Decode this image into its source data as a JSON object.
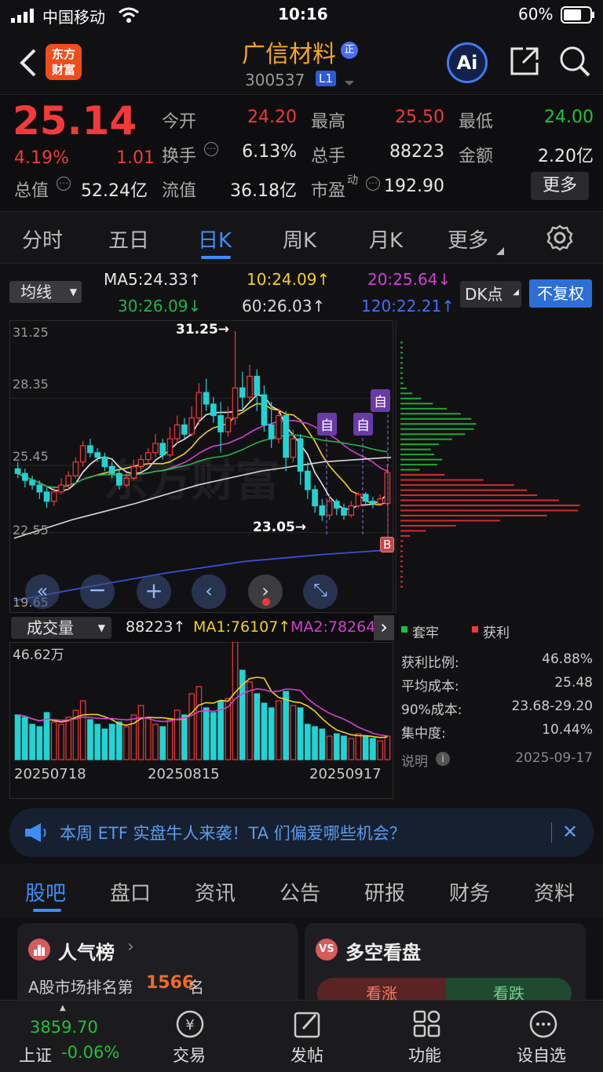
{
  "status": {
    "carrier": "中国移动",
    "time": "10:16",
    "battery": "60%"
  },
  "header": {
    "logo_line1": "东方",
    "logo_line2": "财富",
    "stock_name": "广信材料",
    "badge": "正",
    "code": "300537",
    "level": "L1",
    "ai": "Ai"
  },
  "quote": {
    "price": "25.14",
    "change_pct": "4.19%",
    "change": "1.01",
    "fields": [
      {
        "label": "今开",
        "value": "24.20"
      },
      {
        "label": "最高",
        "value": "25.50"
      },
      {
        "label": "最低",
        "value": "24.00"
      },
      {
        "label": "换手",
        "value": "6.13%"
      },
      {
        "label": "总手",
        "value": "88223"
      },
      {
        "label": "金额",
        "value": "2.20亿"
      },
      {
        "label": "总值",
        "value": "52.24亿"
      },
      {
        "label": "流值",
        "value": "36.18亿"
      },
      {
        "label": "市盈",
        "label_sup": "动",
        "value": "192.90"
      }
    ],
    "more": "更多"
  },
  "tabs": [
    "分时",
    "五日",
    "日K",
    "周K",
    "月K",
    "更多"
  ],
  "ma_bar": {
    "selector": "均线",
    "items": [
      {
        "text": "MA5:24.33↑",
        "color": "#e6e6e6"
      },
      {
        "text": "10:24.09↑",
        "color": "#f2d023"
      },
      {
        "text": "20:25.64↓",
        "color": "#d43fd4"
      },
      {
        "text": "30:26.09↓",
        "color": "#22b34a"
      },
      {
        "text": "60:26.03↑",
        "color": "#d9d9d9"
      },
      {
        "text": "120:22.21↑",
        "color": "#4a6cf0"
      }
    ],
    "dk": "DK点",
    "fq": "不复权"
  },
  "chart_data": {
    "type": "candlestick",
    "y_ticks": [
      "31.25",
      "28.35",
      "25.45",
      "22.55",
      "19.65"
    ],
    "ylim": [
      19.65,
      31.25
    ],
    "annotations": {
      "high": "31.25→",
      "low": "23.05→",
      "marker": "自",
      "buy": "B"
    },
    "watermark": "东方财富",
    "candles": [
      [
        25.3,
        25.1,
        24.9,
        25.6
      ],
      [
        25.1,
        24.8,
        24.5,
        25.3
      ],
      [
        24.8,
        24.6,
        24.4,
        25.0
      ],
      [
        24.6,
        24.3,
        24.0,
        24.8
      ],
      [
        24.3,
        23.9,
        23.6,
        24.5
      ],
      [
        23.9,
        24.3,
        23.7,
        24.5
      ],
      [
        24.3,
        24.6,
        24.2,
        24.9
      ],
      [
        24.6,
        25.0,
        24.4,
        25.2
      ],
      [
        25.0,
        25.6,
        24.9,
        25.8
      ],
      [
        25.6,
        26.3,
        25.4,
        26.5
      ],
      [
        26.3,
        26.0,
        25.8,
        26.6
      ],
      [
        26.0,
        25.8,
        25.6,
        26.2
      ],
      [
        25.8,
        25.4,
        25.2,
        26.0
      ],
      [
        25.4,
        25.1,
        24.9,
        25.6
      ],
      [
        25.1,
        24.6,
        24.4,
        25.3
      ],
      [
        24.6,
        24.9,
        24.5,
        25.1
      ],
      [
        24.9,
        25.4,
        24.8,
        25.7
      ],
      [
        25.4,
        25.7,
        25.2,
        25.9
      ],
      [
        25.7,
        26.0,
        25.5,
        26.2
      ],
      [
        26.0,
        26.4,
        25.8,
        26.8
      ],
      [
        26.4,
        25.9,
        25.7,
        26.6
      ],
      [
        25.9,
        26.6,
        25.8,
        27.1
      ],
      [
        26.6,
        27.2,
        26.4,
        27.6
      ],
      [
        27.2,
        26.8,
        26.6,
        27.5
      ],
      [
        26.8,
        27.5,
        26.7,
        28.0
      ],
      [
        27.5,
        28.6,
        27.2,
        29.0
      ],
      [
        28.6,
        28.1,
        27.8,
        29.2
      ],
      [
        28.1,
        27.6,
        27.3,
        28.4
      ],
      [
        27.6,
        26.9,
        26.0,
        28.2
      ],
      [
        26.9,
        27.5,
        26.7,
        28.0
      ],
      [
        27.5,
        28.8,
        27.2,
        31.25
      ],
      [
        28.8,
        28.4,
        27.9,
        29.5
      ],
      [
        28.4,
        29.3,
        28.2,
        29.8
      ],
      [
        29.3,
        28.5,
        27.8,
        29.6
      ],
      [
        28.5,
        27.2,
        26.9,
        28.9
      ],
      [
        27.2,
        26.6,
        26.2,
        28.2
      ],
      [
        26.6,
        27.6,
        26.4,
        27.9
      ],
      [
        27.6,
        25.8,
        25.2,
        27.8
      ],
      [
        25.8,
        26.6,
        25.6,
        27.0
      ],
      [
        26.6,
        25.2,
        24.6,
        26.8
      ],
      [
        25.2,
        24.4,
        24.0,
        25.6
      ],
      [
        24.4,
        23.7,
        23.4,
        24.6
      ],
      [
        23.7,
        23.3,
        23.05,
        24.0
      ],
      [
        23.3,
        23.9,
        23.1,
        24.2
      ],
      [
        23.9,
        23.6,
        23.3,
        24.0
      ],
      [
        23.6,
        23.3,
        23.1,
        23.8
      ],
      [
        23.3,
        23.7,
        23.2,
        23.9
      ],
      [
        23.7,
        24.2,
        23.6,
        24.3
      ],
      [
        24.2,
        23.9,
        23.7,
        24.3
      ],
      [
        23.9,
        23.8,
        23.6,
        24.1
      ],
      [
        23.8,
        24.0,
        23.7,
        24.2
      ],
      [
        23.8,
        25.14,
        23.7,
        25.5
      ]
    ],
    "volume": {
      "max_label": "46.62万",
      "value": "88223↑",
      "ma1": "MA1:76107↑",
      "ma2": "MA2:78264↑"
    },
    "dates": [
      "20250718",
      "20250815",
      "20250917"
    ]
  },
  "vol_selector": "成交量",
  "chip": {
    "legend": [
      "套牢",
      "获利"
    ],
    "rows": [
      {
        "label": "获利比例:",
        "value": "46.88%"
      },
      {
        "label": "平均成本:",
        "value": "25.48"
      },
      {
        "label": "90%成本:",
        "value": "23.68-29.20"
      },
      {
        "label": "集中度:",
        "value": "10.44%"
      }
    ],
    "note": "说明",
    "date": "2025-09-17"
  },
  "banner": "本周 ETF 实盘牛人来袭！TA 们偏爱哪些机会？",
  "bottom_tabs": [
    "股吧",
    "盘口",
    "资讯",
    "公告",
    "研报",
    "财务",
    "资料"
  ],
  "cards": {
    "left_title": "人气榜",
    "left_sub": "A股市场排名第",
    "rank": "1566",
    "rank_suffix": "名",
    "right_title": "多空看盘",
    "up": "看涨",
    "down": "看跌"
  },
  "dock": {
    "index_value": "3859.70",
    "index_name": "上证",
    "index_change": "-0.06%",
    "items": [
      "交易",
      "发帖",
      "功能",
      "设自选"
    ]
  }
}
